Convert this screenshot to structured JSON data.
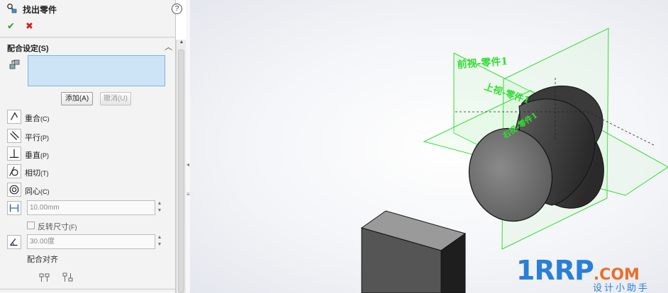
{
  "panel": {
    "title": "找出零件",
    "help_icon": "help-icon",
    "ok": "✔",
    "cancel": "✖",
    "section": {
      "title": "配合设定(S)",
      "add_label": "添加(A)",
      "undo_label": "撤消(U)"
    },
    "mates": {
      "coincident": {
        "label": "重合",
        "key": "(C)",
        "icon": "coincident-icon"
      },
      "parallel": {
        "label": "平行",
        "key": "(P)",
        "icon": "parallel-icon"
      },
      "perpendicular": {
        "label": "垂直",
        "key": "(P)",
        "icon": "perpendicular-icon"
      },
      "tangent": {
        "label": "相切",
        "key": "(T)",
        "icon": "tangent-icon"
      },
      "concentric": {
        "label": "同心",
        "key": "(C)",
        "icon": "concentric-icon"
      }
    },
    "distance_value": "10.00mm",
    "flip_label": "反转尺寸",
    "flip_key": "(F)",
    "angle_value": "30.00度",
    "alignment_heading": "配合对齐"
  },
  "viewport": {
    "plane_labels": {
      "front": "前视-零件1",
      "top": "上视-零件1",
      "right": "右视-零件1"
    },
    "colors": {
      "plane": "#33dd33",
      "plane_fill": "#c9f5c9",
      "cylinder_dark": "#3c3c3c",
      "cylinder_light": "#7a7a7a",
      "box_front": "#555555"
    }
  },
  "watermark": {
    "main": "1RRP",
    "suffix": ".COM",
    "sub": "设计小助手"
  }
}
